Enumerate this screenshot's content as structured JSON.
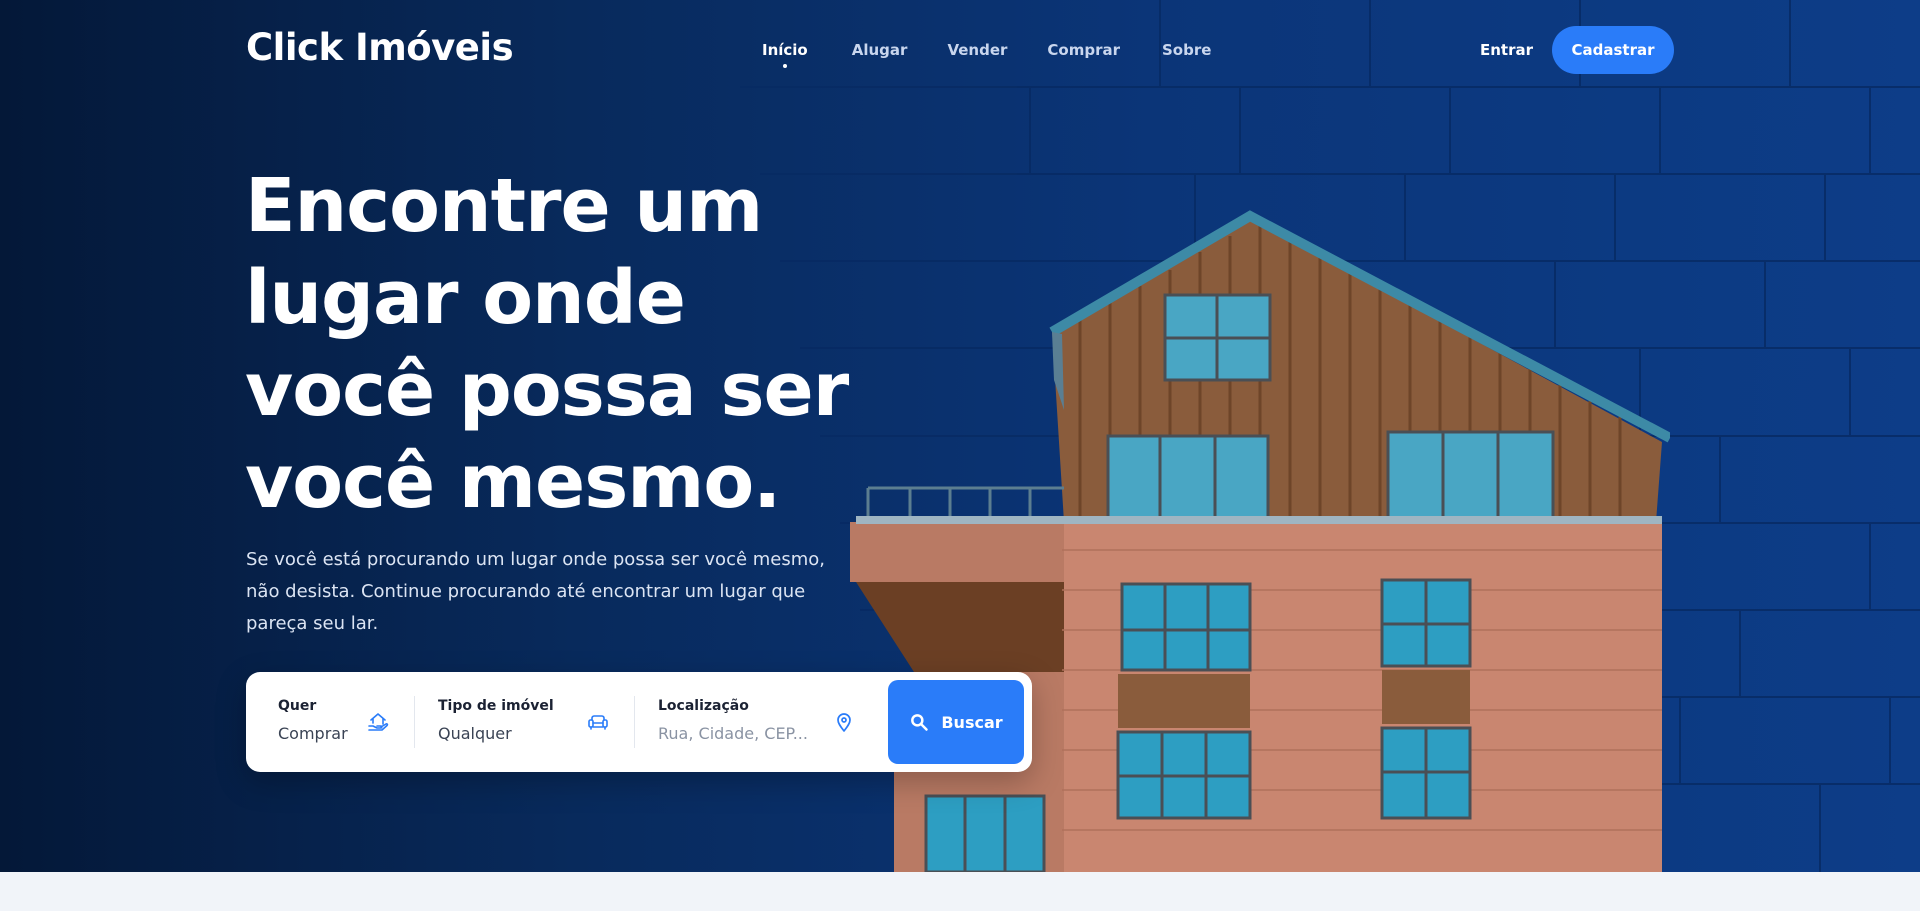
{
  "brand": {
    "name": "Click Imóveis"
  },
  "nav": {
    "items": [
      {
        "label": "Início",
        "active": true
      },
      {
        "label": "Alugar",
        "active": false
      },
      {
        "label": "Vender",
        "active": false
      },
      {
        "label": "Comprar",
        "active": false
      },
      {
        "label": "Sobre",
        "active": false
      }
    ],
    "login_label": "Entrar",
    "signup_label": "Cadastrar"
  },
  "hero": {
    "headline_lines": [
      "Encontre um",
      "lugar onde",
      "você possa ser",
      "você mesmo."
    ],
    "subtext": "Se você está procurando um lugar onde possa ser você mesmo, não desista. Continue procurando até encontrar um lugar que pareça seu lar."
  },
  "search": {
    "want": {
      "label": "Quer",
      "value": "Comprar",
      "icon": "house-hand-icon"
    },
    "type": {
      "label": "Tipo de imóvel",
      "value": "Qualquer",
      "icon": "sofa-icon"
    },
    "location": {
      "label": "Localização",
      "placeholder": "Rua, Cidade, CEP...",
      "icon": "map-pin-icon"
    },
    "button_label": "Buscar"
  },
  "colors": {
    "accent": "#2a7cf9",
    "hero_dark": "#041838",
    "hero_blue": "#0d3d88",
    "page_bg": "#f1f4f9"
  }
}
